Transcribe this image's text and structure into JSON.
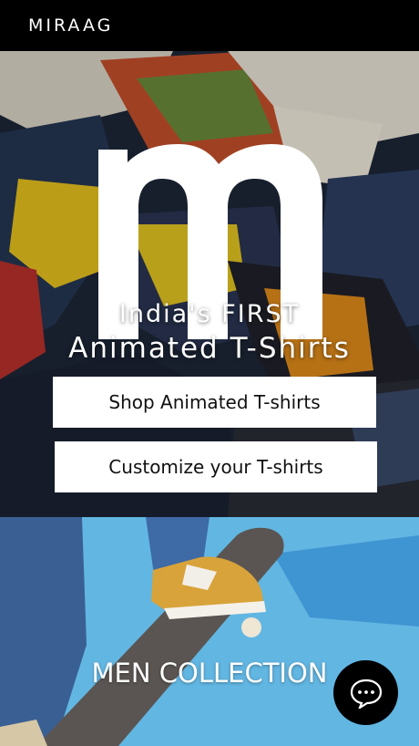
{
  "header": {
    "brand": "MIRAAG"
  },
  "hero": {
    "logo": "m-logo",
    "tagline_line1": "India's FIRST",
    "tagline_line2": "Animated T-Shirts",
    "buttons": [
      {
        "label": "Shop Animated T-shirts"
      },
      {
        "label": "Customize your T-shirts"
      }
    ]
  },
  "collections": [
    {
      "title": "MEN COLLECTION"
    }
  ],
  "chat": {
    "icon": "chat-bubble-icon"
  },
  "colors": {
    "topbar": "#000000",
    "button_bg": "#ffffff",
    "men_bg": "#5fb3e0"
  }
}
